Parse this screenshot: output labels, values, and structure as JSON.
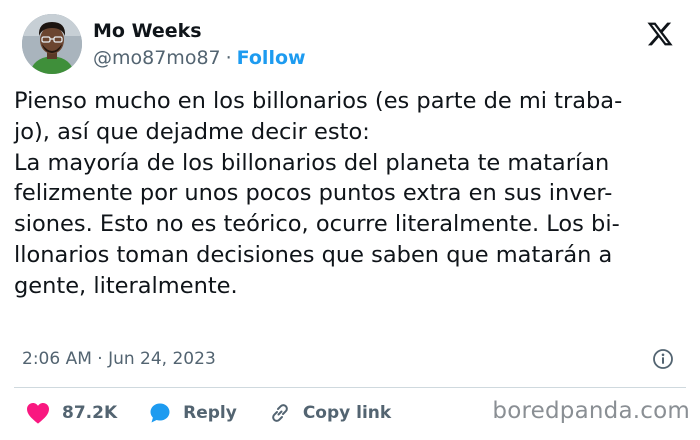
{
  "author": {
    "name": "Mo Weeks",
    "handle": "@mo87mo87",
    "separator": "·",
    "follow_label": "Follow"
  },
  "logo": {
    "icon": "x-logo-icon"
  },
  "tweet": {
    "lines": [
      "Pienso mucho en los billonarios (es parte de mi traba-",
      "jo), así que dejadme decir esto:",
      "La mayoría de los billonarios del planeta te matarían",
      "felizmente por unos pocos puntos extra en sus inver-",
      "siones. Esto no es teórico, ocurre literalmente. Los bi-",
      "llonarios toman decisiones que saben que matarán a",
      "gente, literalmente."
    ],
    "timestamp": "2:06 AM · Jun 24, 2023"
  },
  "actions": {
    "likes": {
      "icon": "heart-icon",
      "count": "87.2K",
      "color": "#f91880"
    },
    "reply": {
      "icon": "speech-bubble-icon",
      "label": "Reply",
      "color": "#1d9bf0"
    },
    "copy_link": {
      "icon": "link-icon",
      "label": "Copy link"
    }
  },
  "info": {
    "icon": "info-icon"
  },
  "watermark": "boredpanda.com",
  "colors": {
    "accent": "#1d9bf0",
    "like": "#f91880",
    "text": "#0f1419",
    "secondary": "#536471"
  }
}
